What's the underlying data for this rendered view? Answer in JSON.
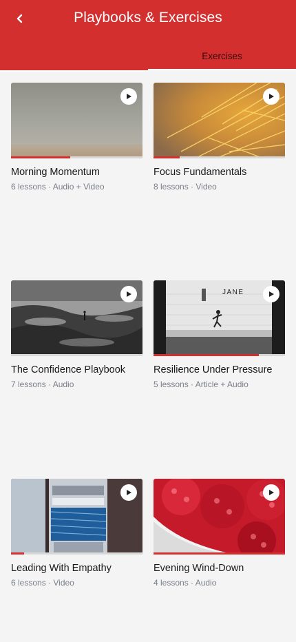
{
  "header": {
    "title": "Playbooks & Exercises",
    "back_icon": "chevron-left-icon",
    "tabs": [
      {
        "label": "",
        "selected": false
      },
      {
        "label": "Exercises",
        "selected": true
      }
    ],
    "accent_color": "#d32f2f"
  },
  "cards": [
    {
      "title": "Morning Momentum",
      "meta": "6 lessons · Audio + Video",
      "progress": 0.45,
      "image": "misty-grey-landscape"
    },
    {
      "title": "Focus Fundamentals",
      "meta": "8 lessons · Video",
      "progress": 0.2,
      "image": "golden-pine-needles"
    },
    {
      "title": "The Confidence Playbook",
      "meta": "7 lessons · Audio",
      "progress": 0,
      "image": "person-on-rocky-shore"
    },
    {
      "title": "Resilience Under Pressure",
      "meta": "5 lessons · Article + Audio",
      "progress": 0.8,
      "image": "child-running-subway-platform",
      "sign_text": "JANE"
    },
    {
      "title": "Leading With Empathy",
      "meta": "6 lessons · Video",
      "progress": 0.1,
      "image": "sailboat-winch-rope"
    },
    {
      "title": "Evening Wind-Down",
      "meta": "4 lessons · Audio",
      "progress": 1.0,
      "image": "raspberries-in-bowl"
    }
  ]
}
